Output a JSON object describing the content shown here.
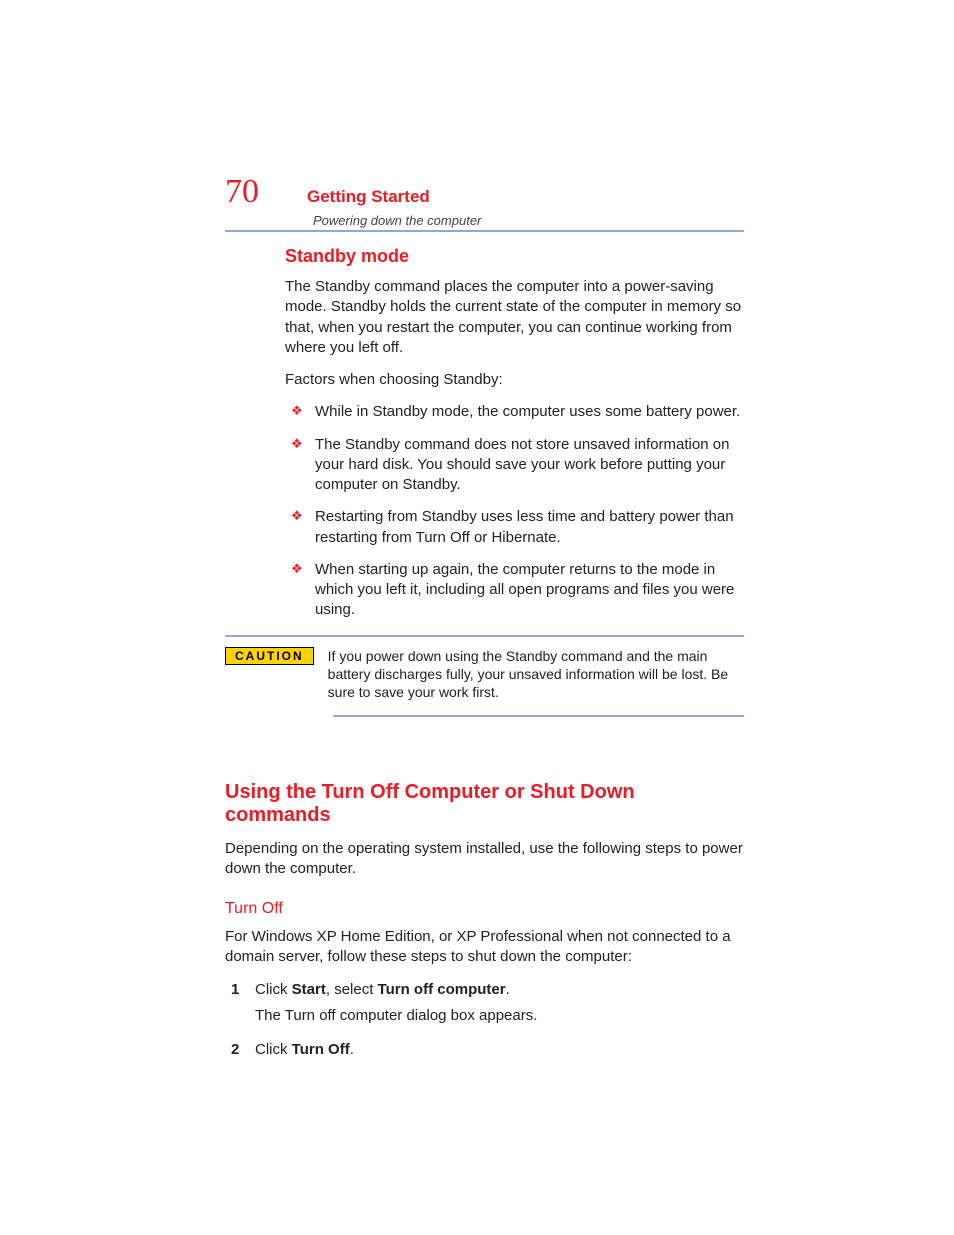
{
  "header": {
    "page_number": "70",
    "chapter": "Getting Started",
    "subchapter": "Powering down the computer"
  },
  "section1": {
    "heading": "Standby mode",
    "intro1": "The Standby command places the computer into a power-saving mode. Standby holds the current state of the computer in memory so that, when you restart the computer, you can continue working from where you left off.",
    "intro2": "Factors when choosing Standby:",
    "bullets": [
      "While in Standby mode, the computer uses some battery power.",
      "The Standby command does not store unsaved information on your hard disk. You should save your work before putting your computer on Standby.",
      "Restarting from Standby uses less time and battery power than restarting from Turn Off or Hibernate.",
      "When starting up again, the computer returns to the mode in which you left it, including all open programs and files you were using."
    ]
  },
  "caution": {
    "label": "CAUTION",
    "text": "If you power down using the Standby command and the main battery discharges fully, your unsaved information will be lost. Be sure to save your work first."
  },
  "section2": {
    "heading": "Using the Turn Off Computer or Shut Down commands",
    "para": "Depending on the operating system installed, use the following steps to power down the computer.",
    "turnoff": {
      "heading": "Turn Off",
      "intro": "For Windows XP Home Edition, or XP Professional when not connected to a domain server, follow these steps to shut down the computer:",
      "step1_a": "Click ",
      "step1_b": "Start",
      "step1_c": ", select ",
      "step1_d": "Turn off computer",
      "step1_e": ".",
      "step1_sub": "The Turn off computer dialog box appears.",
      "step2_a": "Click ",
      "step2_b": "Turn Off",
      "step2_c": "."
    }
  }
}
